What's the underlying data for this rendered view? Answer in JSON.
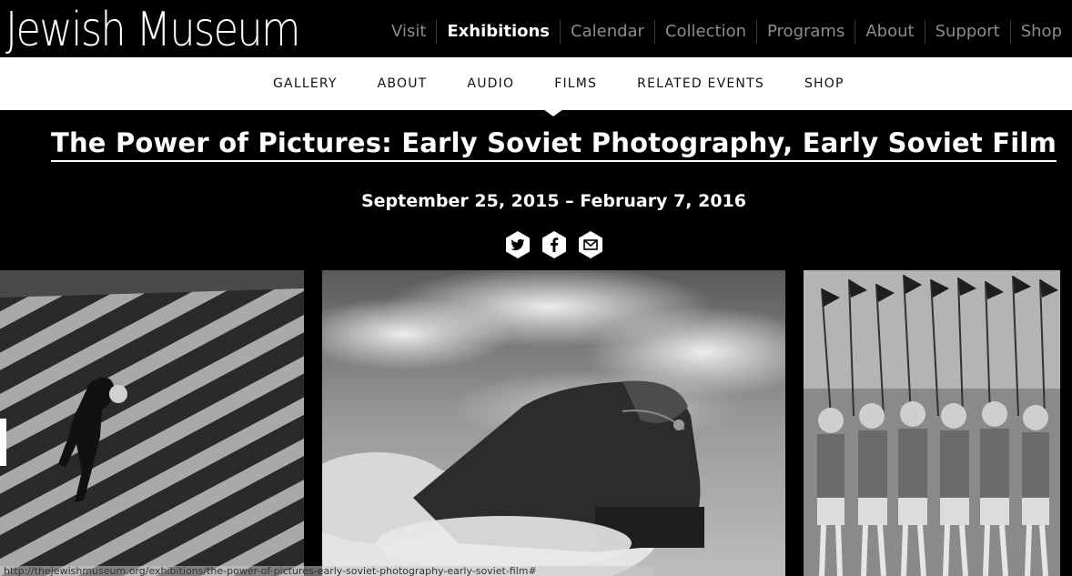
{
  "site": {
    "logo": "Jewish Museum"
  },
  "main_nav": [
    {
      "label": "Visit",
      "active": false
    },
    {
      "label": "Exhibitions",
      "active": true
    },
    {
      "label": "Calendar",
      "active": false
    },
    {
      "label": "Collection",
      "active": false
    },
    {
      "label": "Programs",
      "active": false
    },
    {
      "label": "About",
      "active": false
    },
    {
      "label": "Support",
      "active": false
    },
    {
      "label": "Shop",
      "active": false
    }
  ],
  "sub_nav": [
    {
      "label": "GALLERY"
    },
    {
      "label": "ABOUT"
    },
    {
      "label": "AUDIO"
    },
    {
      "label": "FILMS",
      "active": true
    },
    {
      "label": "RELATED EVENTS"
    },
    {
      "label": "SHOP"
    }
  ],
  "exhibition": {
    "title": "The Power of Pictures: Early Soviet Photography, Early Soviet Film",
    "dates": "September 25, 2015 – February 7, 2016"
  },
  "share_icons": [
    "twitter-icon",
    "facebook-icon",
    "email-icon"
  ],
  "gallery": {
    "photos": [
      "staircase-photo",
      "locomotive-photo",
      "parade-photo"
    ]
  },
  "status_url": "http://thejewishmuseum.org/exhibitions/the-power-of-pictures-early-soviet-photography-early-soviet-film#"
}
